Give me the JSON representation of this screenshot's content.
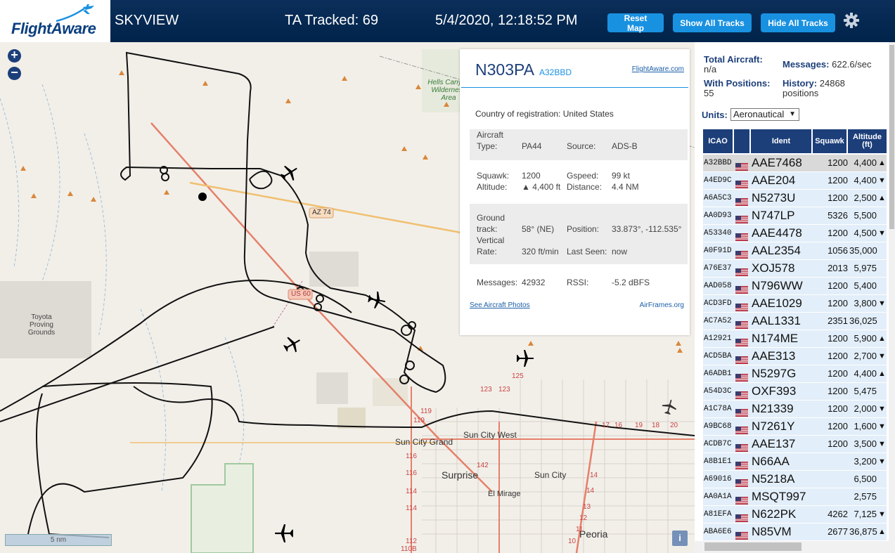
{
  "header": {
    "logo_text": "FlightAware",
    "app_name": "SKYVIEW",
    "tracked": "TA Tracked: 69",
    "datetime": "5/4/2020, 12:18:52 PM",
    "btn_reset": "Reset Map",
    "btn_show": "Show All Tracks",
    "btn_hide": "Hide All Tracks",
    "settings_icon": "gear-icon"
  },
  "map": {
    "zoom_in": "+",
    "zoom_out": "−",
    "scale_label": "5 nm",
    "info": "i",
    "labels": {
      "hells_canyon": "Hells Canyon Wilderness Area",
      "toyota": "Toyota Proving Grounds",
      "az74": "AZ 74",
      "us60": "US 60",
      "sun_city_grand": "Sun City Grand",
      "sun_city_west": "Sun City West",
      "surprise": "Surprise",
      "sun_city": "Sun City",
      "el_mirage": "El Mirage",
      "peoria": "Peoria"
    },
    "road_numbers": [
      "123",
      "123",
      "125",
      "119",
      "119",
      "116",
      "116",
      "114",
      "114",
      "112",
      "110B",
      "142",
      "14",
      "14",
      "13",
      "12",
      "11",
      "10",
      "17",
      "16",
      "19",
      "18",
      "20"
    ]
  },
  "selected": {
    "callsign": "N303PA",
    "hex": "A32BBD",
    "fa_link": "FlightAware.com",
    "country_label": "Country of registration:",
    "country": "United States",
    "aircraft_type_label": "Aircraft Type:",
    "aircraft_type": "PA44",
    "source_label": "Source:",
    "source": "ADS-B",
    "squawk_label": "Squawk:",
    "squawk": "1200",
    "altitude_label": "Altitude:",
    "altitude": "▲ 4,400 ft",
    "gspeed_label": "Gspeed:",
    "gspeed": "99 kt",
    "distance_label": "Distance:",
    "distance": "4.4 NM",
    "track_label": "Ground track:",
    "track": "58° (NE)",
    "position_label": "Position:",
    "position": "33.873°, -112.535°",
    "vrate_label": "Vertical Rate:",
    "vrate": "320 ft/min",
    "lastseen_label": "Last Seen:",
    "lastseen": "now",
    "messages_label": "Messages:",
    "messages": "42932",
    "rssi_label": "RSSI:",
    "rssi": "-5.2 dBFS",
    "photos_link": "See Aircraft Photos",
    "airframes_link": "AirFrames.org"
  },
  "sidebar": {
    "total_label": "Total Aircraft:",
    "total": "n/a",
    "messages_label": "Messages:",
    "messages": "622.6/sec",
    "positions_label": "With Positions:",
    "positions": "55",
    "history_label": "History:",
    "history": "24868 positions",
    "units_label": "Units:",
    "units_value": "Aeronautical",
    "columns": [
      "ICAO",
      "",
      "Ident",
      "Squawk",
      "Altitude (ft)"
    ],
    "rows": [
      {
        "icao": "A32BBD",
        "ident": "AAE7468",
        "squawk": "1200",
        "alt": "4,400",
        "vr": "▲"
      },
      {
        "icao": "A4ED9C",
        "ident": "AAE204",
        "squawk": "1200",
        "alt": "4,400",
        "vr": "▼"
      },
      {
        "icao": "A6A5C3",
        "ident": "N5273U",
        "squawk": "1200",
        "alt": "2,500",
        "vr": "▲"
      },
      {
        "icao": "AA0D93",
        "ident": "N747LP",
        "squawk": "5326",
        "alt": "5,500",
        "vr": ""
      },
      {
        "icao": "A53340",
        "ident": "AAE4478",
        "squawk": "1200",
        "alt": "4,500",
        "vr": "▼"
      },
      {
        "icao": "A0F91D",
        "ident": "AAL2354",
        "squawk": "1056",
        "alt": "35,000",
        "vr": ""
      },
      {
        "icao": "A76E37",
        "ident": "XOJ578",
        "squawk": "2013",
        "alt": "5,975",
        "vr": ""
      },
      {
        "icao": "AAD058",
        "ident": "N796WW",
        "squawk": "1200",
        "alt": "5,400",
        "vr": ""
      },
      {
        "icao": "ACD3FD",
        "ident": "AAE1029",
        "squawk": "1200",
        "alt": "3,800",
        "vr": "▼"
      },
      {
        "icao": "AC7A52",
        "ident": "AAL1331",
        "squawk": "2351",
        "alt": "36,025",
        "vr": ""
      },
      {
        "icao": "A12921",
        "ident": "N174ME",
        "squawk": "1200",
        "alt": "5,900",
        "vr": "▲"
      },
      {
        "icao": "ACD5BA",
        "ident": "AAE313",
        "squawk": "1200",
        "alt": "2,700",
        "vr": "▼"
      },
      {
        "icao": "A6ADB1",
        "ident": "N5297G",
        "squawk": "1200",
        "alt": "4,400",
        "vr": "▲"
      },
      {
        "icao": "A54D3C",
        "ident": "OXF393",
        "squawk": "1200",
        "alt": "5,475",
        "vr": ""
      },
      {
        "icao": "A1C78A",
        "ident": "N21339",
        "squawk": "1200",
        "alt": "2,000",
        "vr": "▼"
      },
      {
        "icao": "A9BC68",
        "ident": "N7261Y",
        "squawk": "1200",
        "alt": "1,600",
        "vr": "▼"
      },
      {
        "icao": "ACDB7C",
        "ident": "AAE137",
        "squawk": "1200",
        "alt": "3,500",
        "vr": "▼"
      },
      {
        "icao": "A8B1E1",
        "ident": "N66AA",
        "squawk": "",
        "alt": "3,200",
        "vr": "▼"
      },
      {
        "icao": "A69016",
        "ident": "N5218A",
        "squawk": "",
        "alt": "6,500",
        "vr": ""
      },
      {
        "icao": "AA0A1A",
        "ident": "MSQT997",
        "squawk": "",
        "alt": "2,575",
        "vr": ""
      },
      {
        "icao": "A81EFA",
        "ident": "N622PK",
        "squawk": "4262",
        "alt": "7,125",
        "vr": "▼"
      },
      {
        "icao": "ABA6E6",
        "ident": "N85VM",
        "squawk": "2677",
        "alt": "36,875",
        "vr": "▲"
      }
    ]
  },
  "colors": {
    "header_bg": "#00234a",
    "button": "#1991e1",
    "table_header": "#1c3f7a",
    "row_bg": "#e2eef9",
    "selected_row": "#d9d9d9",
    "track_line": "#111111",
    "highway": "#e5806a",
    "state_road": "#f0c070"
  },
  "icons": [
    "logo-plane-icon",
    "gear-icon",
    "plane-icon",
    "us-flag-icon",
    "zoom-in-icon",
    "zoom-out-icon",
    "info-icon"
  ]
}
